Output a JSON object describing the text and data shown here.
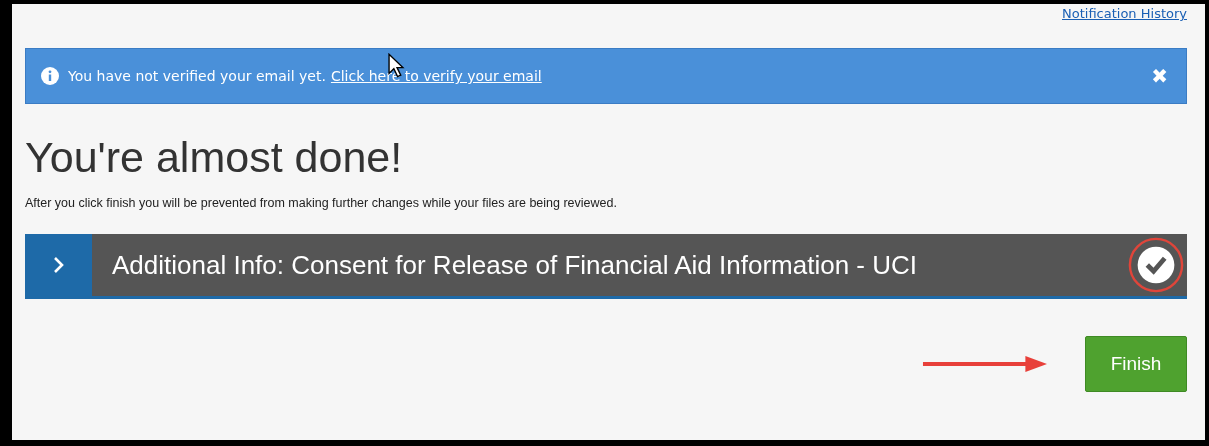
{
  "header_link": "Notification History",
  "alert": {
    "text": "You have not verified your email yet.",
    "link": "Click here to verify your email",
    "close": "✖"
  },
  "heading": "You're almost done!",
  "intro": "After you click finish you will be prevented from making further changes while your files are being reviewed.",
  "sections": [
    {
      "title": "Additional Info: Consent for Release of Financial Aid Information - UCI",
      "expanded": false,
      "completed": true
    }
  ],
  "finish_button": "Finish"
}
